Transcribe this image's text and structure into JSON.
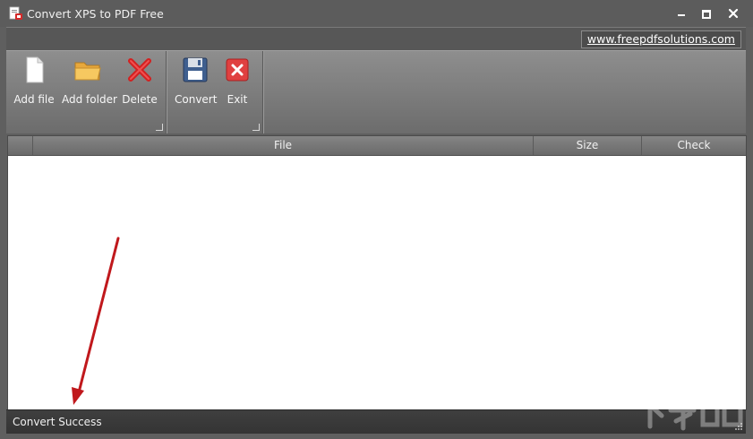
{
  "window": {
    "title": "Convert XPS to PDF Free",
    "controls": {
      "minimize": "minimize-icon",
      "maximize": "maximize-icon",
      "close": "close-icon"
    }
  },
  "header": {
    "url": "www.freepdfsolutions.com"
  },
  "ribbon": {
    "groups": [
      {
        "buttons": [
          {
            "label": "Add file",
            "icon": "file-icon"
          },
          {
            "label": "Add folder",
            "icon": "folder-icon"
          },
          {
            "label": "Delete",
            "icon": "delete-x-icon"
          }
        ]
      },
      {
        "buttons": [
          {
            "label": "Convert",
            "icon": "save-disk-icon"
          },
          {
            "label": "Exit",
            "icon": "exit-icon"
          }
        ]
      }
    ]
  },
  "table": {
    "columns": [
      "",
      "File",
      "Size",
      "Check"
    ],
    "rows": []
  },
  "status": {
    "text": "Convert Success"
  },
  "colors": {
    "titlebar": "#5c5c5c",
    "ribbon_top": "#8e8e8e",
    "ribbon_bottom": "#6c6c6c",
    "statusbar": "#3a3a3a",
    "annotation_arrow": "#c0181c",
    "delete_red": "#d32020"
  }
}
